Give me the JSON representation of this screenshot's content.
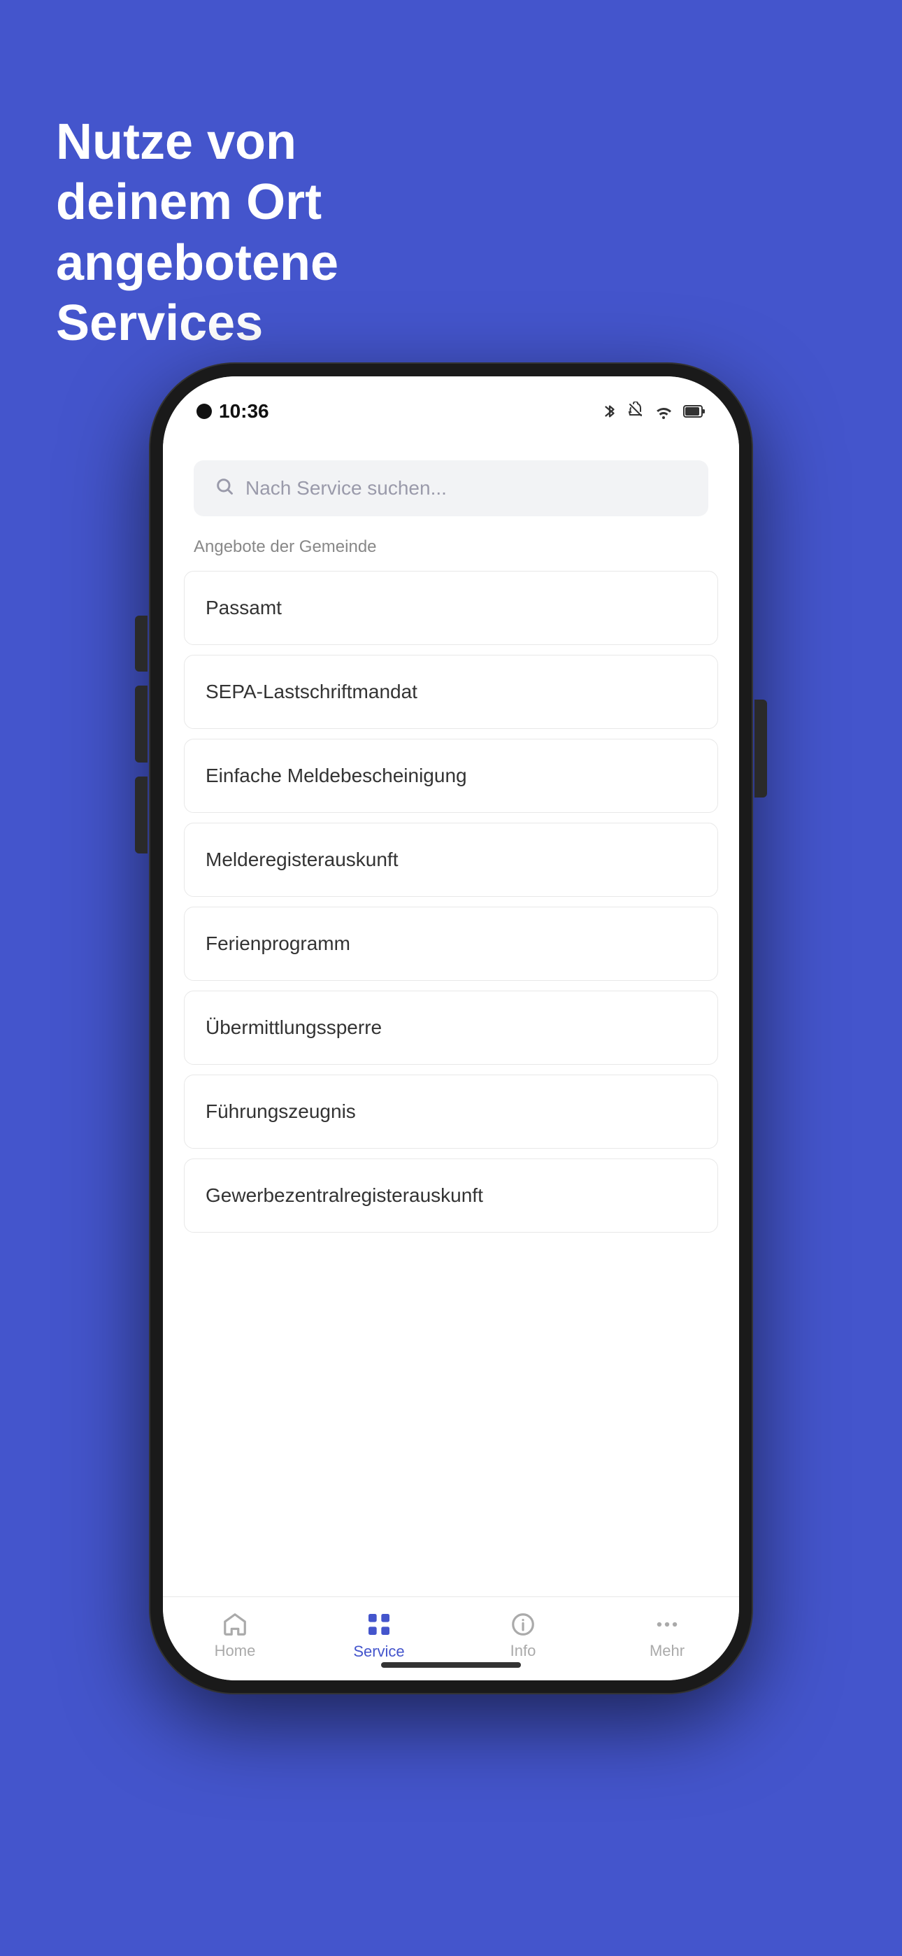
{
  "hero": {
    "title_line1": "Nutze von deinem Ort",
    "title_line2": "angebotene Services"
  },
  "phone": {
    "status_bar": {
      "time": "10:36"
    },
    "search": {
      "placeholder": "Nach Service suchen..."
    },
    "section_label": "Angebote der Gemeinde",
    "services": [
      {
        "name": "Passamt"
      },
      {
        "name": "SEPA-Lastschriftmandat"
      },
      {
        "name": "Einfache Meldebescheinigung"
      },
      {
        "name": "Melderegisterauskunft"
      },
      {
        "name": "Ferienprogramm"
      },
      {
        "name": "Übermittlungssperre"
      },
      {
        "name": "Führungszeugnis"
      },
      {
        "name": "Gewerbezentralregisterauskunft"
      }
    ],
    "nav": {
      "items": [
        {
          "id": "home",
          "label": "Home",
          "active": false
        },
        {
          "id": "service",
          "label": "Service",
          "active": true
        },
        {
          "id": "info",
          "label": "Info",
          "active": false
        },
        {
          "id": "mehr",
          "label": "Mehr",
          "active": false
        }
      ]
    }
  },
  "colors": {
    "background": "#4455cc",
    "active_nav": "#4455cc",
    "inactive_nav": "#aaaaaa"
  }
}
